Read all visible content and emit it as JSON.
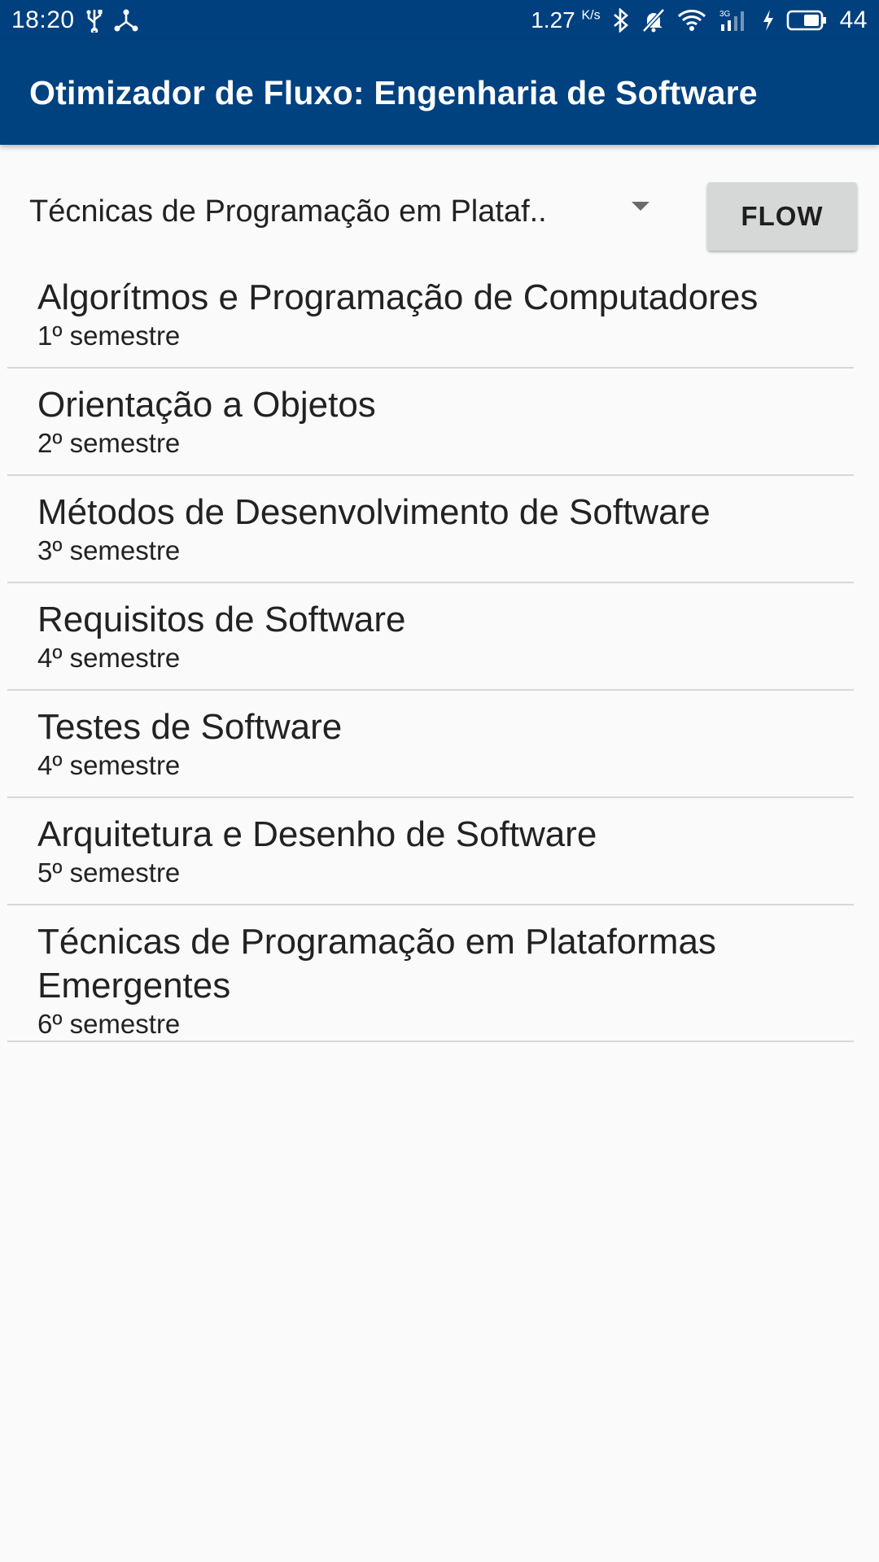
{
  "status_bar": {
    "time": "18:20",
    "network_speed": "1.27",
    "network_speed_unit": "K/s",
    "network_type": "3G",
    "battery_level": "44",
    "icons": [
      "usb-icon",
      "share-icon",
      "bluetooth-icon",
      "muted-bell-icon",
      "wifi-icon",
      "signal-icon",
      "charging-icon",
      "battery-icon"
    ]
  },
  "app_bar": {
    "title": "Otimizador de Fluxo: Engenharia de Software",
    "background_color": "#00417f"
  },
  "controls": {
    "selected_course": "Técnicas de Programação em Plataf..",
    "flow_button_label": "FLOW"
  },
  "courses": [
    {
      "name": "Algorítmos e Programação de Computadores",
      "semester": "1º semestre"
    },
    {
      "name": "Orientação a Objetos",
      "semester": "2º semestre"
    },
    {
      "name": "Métodos de Desenvolvimento de Software",
      "semester": "3º semestre"
    },
    {
      "name": "Requisitos de Software",
      "semester": "4º semestre"
    },
    {
      "name": "Testes de Software",
      "semester": "4º semestre"
    },
    {
      "name": "Arquitetura e Desenho de Software",
      "semester": "5º semestre"
    },
    {
      "name": "Técnicas de Programação em Plataformas Emergentes",
      "semester": "6º semestre"
    }
  ]
}
